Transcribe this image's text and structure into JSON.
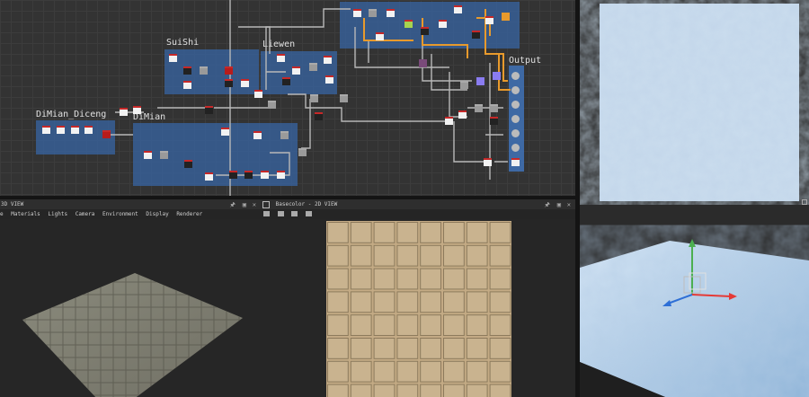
{
  "graph": {
    "frames": [
      {
        "id": "suishi",
        "label": "SuiShi"
      },
      {
        "id": "liewen",
        "label": "Liewen"
      },
      {
        "id": "dimian-diceng",
        "label": "DiMian_Diceng"
      },
      {
        "id": "dimian",
        "label": "DiMian"
      },
      {
        "id": "output",
        "label": "Output"
      }
    ]
  },
  "view3d": {
    "title": "3D VIEW",
    "menu": [
      "Materials",
      "Lights",
      "Camera",
      "Environment",
      "Display",
      "Renderer"
    ],
    "menu_partial": "e"
  },
  "view2d": {
    "title": "Basecolor - 2D VIEW"
  },
  "colors": {
    "frame": "#375f96",
    "output_frame": "#3f6fb0",
    "wire_orange": "#e89a2c",
    "wire_grey": "#b8b8b8",
    "background": "#333333"
  }
}
